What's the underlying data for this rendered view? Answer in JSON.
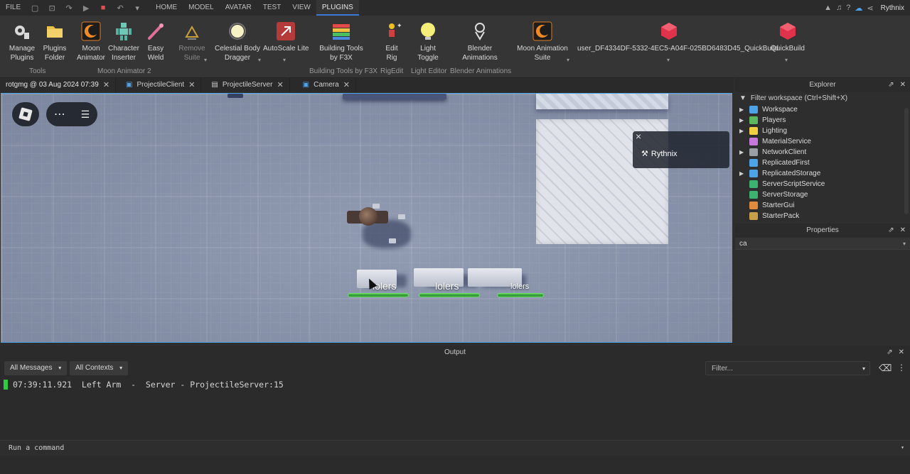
{
  "menubar": {
    "file": "FILE",
    "tabs": [
      "HOME",
      "MODEL",
      "AVATAR",
      "TEST",
      "VIEW",
      "PLUGINS"
    ],
    "active_tab": "PLUGINS",
    "user": "Rythnix"
  },
  "ribbon": {
    "buttons": [
      {
        "label": "Manage\nPlugins",
        "icon": "gear-plug-icon"
      },
      {
        "label": "Plugins\nFolder",
        "icon": "folder-icon"
      },
      {
        "label": "Moon\nAnimator",
        "icon": "moon-icon"
      },
      {
        "label": "Character\nInserter",
        "icon": "character-icon"
      },
      {
        "label": "Easy\nWeld",
        "icon": "weld-icon"
      },
      {
        "label": "Remove\nSuite",
        "icon": "remove-suite-icon"
      },
      {
        "label": "Celestial Body\nDragger",
        "icon": "celestial-icon"
      },
      {
        "label": "AutoScale Lite",
        "icon": "autoscale-icon"
      },
      {
        "label": "Building Tools\nby F3X",
        "icon": "f3x-icon"
      },
      {
        "label": "Edit\nRig",
        "icon": "edit-rig-icon"
      },
      {
        "label": "Light\nToggle",
        "icon": "bulb-icon"
      },
      {
        "label": "Blender\nAnimations",
        "icon": "blender-icon"
      },
      {
        "label": "Moon Animation\nSuite",
        "icon": "moon-suite-icon"
      },
      {
        "label": "user_DF4334DF-5332-4EC5-A04F-025BD6483D45_QuickBuild",
        "icon": "quickbuild-icon"
      },
      {
        "label": "QuickBuild",
        "icon": "quickbuild-icon"
      }
    ],
    "groups": [
      "Tools",
      "Moon Animator 2",
      "Building Tools by F3X",
      "RigEdit",
      "Light Editor",
      "Blender Animations"
    ]
  },
  "doc_tabs": [
    {
      "label": "rotgmg @ 03 Aug 2024 07:39",
      "active": true
    },
    {
      "label": "ProjectileClient"
    },
    {
      "label": "ProjectileServer"
    },
    {
      "label": "Camera"
    }
  ],
  "viewport": {
    "nameplate": "Rythnix",
    "npc_labels": [
      "lolers",
      "lolers",
      "lolers"
    ]
  },
  "explorer": {
    "title": "Explorer",
    "filter": "Filter workspace (Ctrl+Shift+X)",
    "items": [
      {
        "label": "Workspace",
        "expandable": true,
        "color": "#4ea3e8"
      },
      {
        "label": "Players",
        "expandable": true,
        "color": "#5cb85c"
      },
      {
        "label": "Lighting",
        "expandable": true,
        "color": "#f0d040"
      },
      {
        "label": "MaterialService",
        "expandable": false,
        "color": "#c678dd"
      },
      {
        "label": "NetworkClient",
        "expandable": true,
        "color": "#9aa0a6"
      },
      {
        "label": "ReplicatedFirst",
        "expandable": false,
        "color": "#4ea3e8"
      },
      {
        "label": "ReplicatedStorage",
        "expandable": true,
        "color": "#4ea3e8"
      },
      {
        "label": "ServerScriptService",
        "expandable": false,
        "color": "#3cb371"
      },
      {
        "label": "ServerStorage",
        "expandable": false,
        "color": "#3cb371"
      },
      {
        "label": "StarterGui",
        "expandable": false,
        "color": "#e08a3c"
      },
      {
        "label": "StarterPack",
        "expandable": false,
        "color": "#c9a04a"
      }
    ]
  },
  "properties": {
    "title": "Properties",
    "filter_value": "ca"
  },
  "output": {
    "title": "Output",
    "messages_filter": "All Messages",
    "contexts_filter": "All Contexts",
    "filter_placeholder": "Filter...",
    "log": "07:39:11.921  Left Arm  -  Server - ProjectileServer:15"
  },
  "command_bar": {
    "placeholder": "Run a command"
  }
}
